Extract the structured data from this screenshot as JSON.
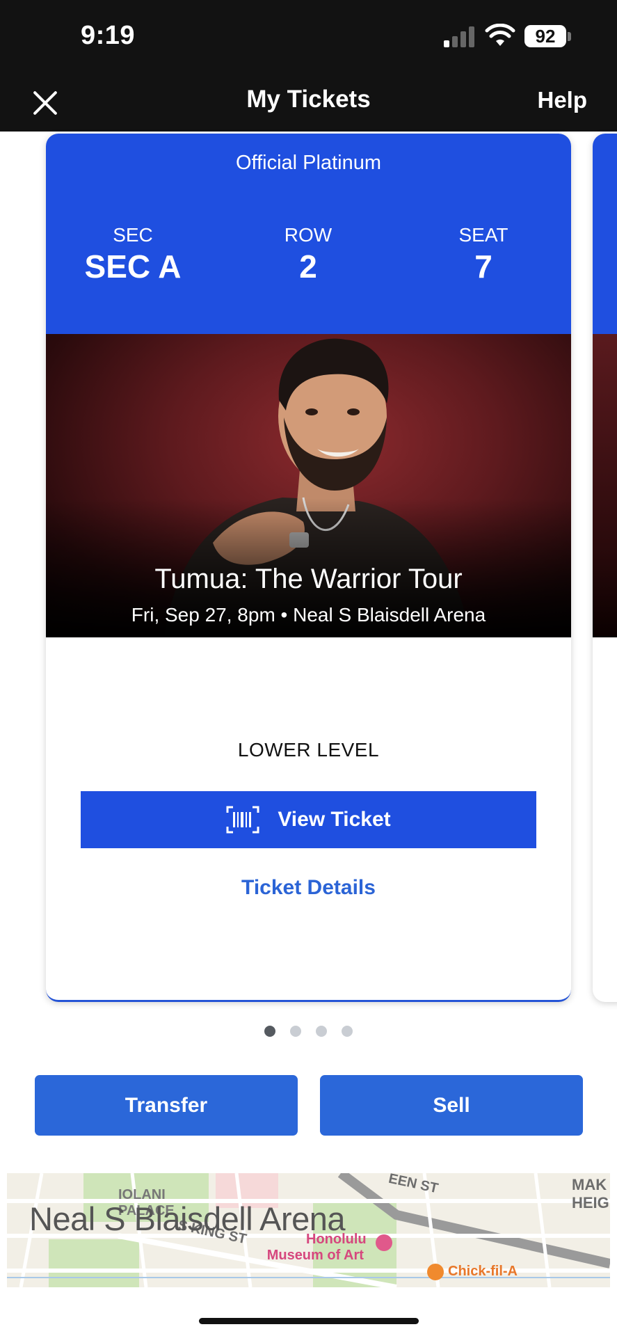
{
  "status": {
    "time": "9:19",
    "battery": "92"
  },
  "nav": {
    "title": "My Tickets",
    "help": "Help"
  },
  "ticket": {
    "type": "Official Platinum",
    "sec_label": "SEC",
    "sec_value": "SEC A",
    "row_label": "ROW",
    "row_value": "2",
    "seat_label": "SEAT",
    "seat_value": "7",
    "event_title": "Tumua: The Warrior Tour",
    "event_info": "Fri, Sep 27, 8pm • Neal S Blaisdell Arena",
    "level": "LOWER LEVEL",
    "view_ticket": "View Ticket",
    "details": "Ticket Details"
  },
  "pager": {
    "count": 4,
    "active": 0
  },
  "actions": {
    "transfer": "Transfer",
    "sell": "Sell"
  },
  "map": {
    "venue": "Neal S Blaisdell Arena",
    "labels": {
      "palace_1": "IOLANI",
      "palace_2": "PALACE",
      "king_st": "S KING ST",
      "een_st": "EEN ST",
      "heights_1": "MAK",
      "heights_2": "HEIGH",
      "museum_1": "Honolulu",
      "museum_2": "Museum of Art",
      "chick": "Chick-fil-A"
    }
  },
  "colors": {
    "ticket_blue": "#1f4fe0",
    "button_blue": "#2b67d9",
    "link_blue": "#2b64d6",
    "dark_bar": "#121212"
  },
  "icons": [
    "signal-icon",
    "wifi-icon",
    "battery-icon",
    "close-icon",
    "barcode-icon",
    "museum-pin-icon",
    "restaurant-pin-icon"
  ]
}
